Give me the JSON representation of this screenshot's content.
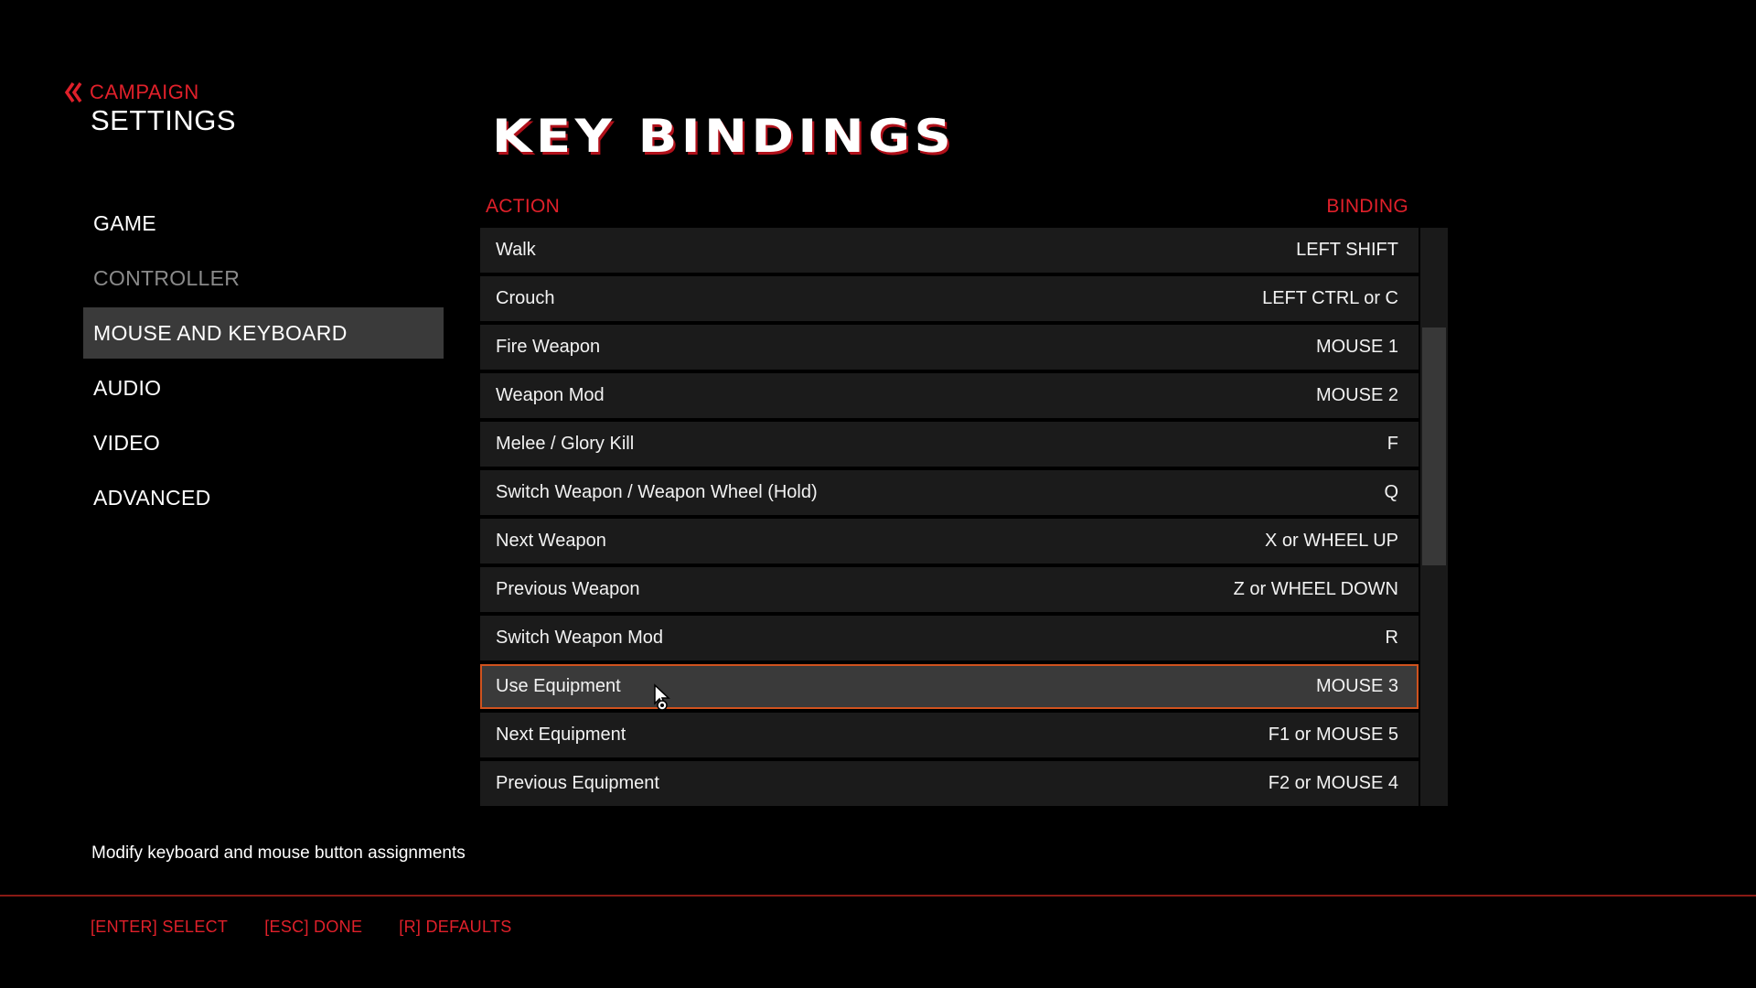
{
  "breadcrumb": {
    "back_label": "CAMPAIGN",
    "back_icon": "double-chevron-left-icon",
    "title": "SETTINGS"
  },
  "sidebar": {
    "items": [
      {
        "label": "GAME",
        "state": "normal"
      },
      {
        "label": "CONTROLLER",
        "state": "dim"
      },
      {
        "label": "MOUSE AND KEYBOARD",
        "state": "active"
      },
      {
        "label": "AUDIO",
        "state": "normal"
      },
      {
        "label": "VIDEO",
        "state": "normal"
      },
      {
        "label": "ADVANCED",
        "state": "normal"
      }
    ]
  },
  "main": {
    "title": "KEY BINDINGS",
    "columns": {
      "action": "ACTION",
      "binding": "BINDING"
    },
    "rows": [
      {
        "action": "Walk",
        "binding": "LEFT SHIFT"
      },
      {
        "action": "Crouch",
        "binding": "LEFT CTRL or C"
      },
      {
        "action": "Fire Weapon",
        "binding": "MOUSE 1"
      },
      {
        "action": "Weapon Mod",
        "binding": "MOUSE 2"
      },
      {
        "action": "Melee / Glory Kill",
        "binding": "F"
      },
      {
        "action": "Switch Weapon / Weapon Wheel (Hold)",
        "binding": "Q"
      },
      {
        "action": "Next Weapon",
        "binding": "X or WHEEL UP"
      },
      {
        "action": "Previous Weapon",
        "binding": "Z or WHEEL DOWN"
      },
      {
        "action": "Switch Weapon Mod",
        "binding": "R"
      },
      {
        "action": "Use Equipment",
        "binding": "MOUSE 3",
        "selected": true
      },
      {
        "action": "Next Equipment",
        "binding": "F1 or MOUSE 5"
      },
      {
        "action": "Previous Equipment",
        "binding": "F2 or MOUSE 4"
      }
    ]
  },
  "description": "Modify keyboard and mouse button assignments",
  "footer": {
    "select": "[ENTER] SELECT",
    "done": "[ESC] DONE",
    "defaults": "[R] DEFAULTS"
  },
  "colors": {
    "accent_red": "#e0202a",
    "selection_border": "#d0521e",
    "row_bg": "#1b1b1b",
    "active_bg": "#3a3a3a"
  }
}
